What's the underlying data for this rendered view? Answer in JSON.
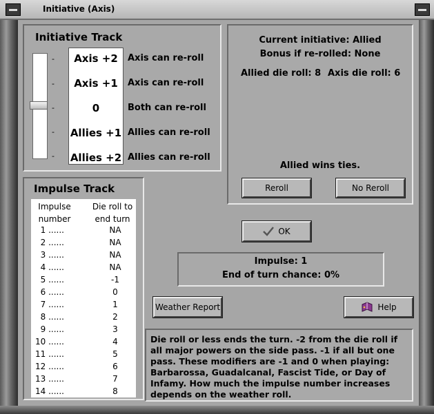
{
  "window": {
    "title": "Initiative (Axis)"
  },
  "initiative_track": {
    "title": "Initiative Track",
    "slider_position": 0,
    "levels": [
      {
        "value": "Axis +2",
        "desc": "Axis can re-roll"
      },
      {
        "value": "Axis +1",
        "desc": "Axis can re-roll"
      },
      {
        "value": "0",
        "desc": "Both can re-roll"
      },
      {
        "value": "Allies +1",
        "desc": "Allies can re-roll"
      },
      {
        "value": "Allies +2",
        "desc": "Allies can re-roll"
      }
    ],
    "tick": "-"
  },
  "status": {
    "current_initiative": "Current initiative: Allied",
    "bonus": "Bonus if re-rolled: None",
    "allied_roll": "Allied die roll: 8",
    "axis_roll": "Axis die roll: 6",
    "ties": "Allied wins ties.",
    "reroll_label": "Reroll",
    "no_reroll_label": "No Reroll"
  },
  "impulse_track": {
    "title": "Impulse Track",
    "col1_header": [
      "Impulse",
      "number"
    ],
    "col2_header": [
      "Die roll to",
      "end turn"
    ],
    "rows": [
      {
        "num": "1 ......",
        "val": "NA"
      },
      {
        "num": "2 ......",
        "val": "NA"
      },
      {
        "num": "3 ......",
        "val": "NA"
      },
      {
        "num": "4 ......",
        "val": "NA"
      },
      {
        "num": "5 ......",
        "val": "-1"
      },
      {
        "num": "6 ......",
        "val": "0"
      },
      {
        "num": "7 ......",
        "val": "1"
      },
      {
        "num": "8 ......",
        "val": "2"
      },
      {
        "num": "9 ......",
        "val": "3"
      },
      {
        "num": "10 ......",
        "val": "4"
      },
      {
        "num": "11 ......",
        "val": "5"
      },
      {
        "num": "12 ......",
        "val": "6"
      },
      {
        "num": "13 ......",
        "val": "7"
      },
      {
        "num": "14 ......",
        "val": "8"
      }
    ]
  },
  "ok_label": "OK",
  "impulse_info": {
    "impulse": "Impulse: 1",
    "end_chance": "End of turn chance: 0%"
  },
  "weather_label": "Weather Report",
  "help_label": "Help",
  "note": "Die roll or less ends the turn.  -2 from the die roll if all major powers on the side pass.  -1 if all but one pass.  These modifiers are -1 and 0 when playing: Barbarossa, Guadalcanal, Fascist Tide, or Day of Infamy.  How much the impulse number increases depends on the weather roll.",
  "icons": {
    "ok": "checkmark-icon",
    "help": "help-book-icon"
  }
}
